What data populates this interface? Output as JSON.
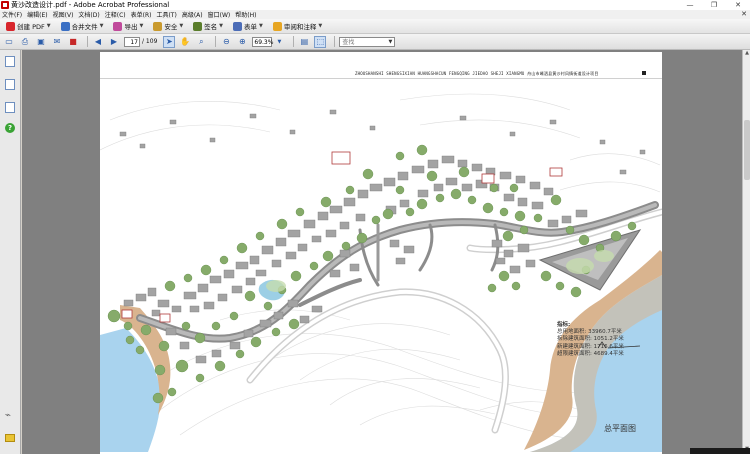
{
  "window": {
    "title": "黄沙改造设计.pdf - Adobe Acrobat Professional",
    "controls": [
      "—",
      "❐",
      "✕"
    ]
  },
  "menu": {
    "items": [
      "文件(F)",
      "编辑(E)",
      "视图(V)",
      "文档(D)",
      "注释(C)",
      "表单(R)",
      "工具(T)",
      "高级(A)",
      "窗口(W)",
      "帮助(H)"
    ]
  },
  "toolbar": {
    "create_pdf": "创建 PDF",
    "merge_files": "合并文件",
    "export": "导出",
    "secure": "安全",
    "sign": "签名",
    "forms": "表单",
    "review_comment": "审阅和注释"
  },
  "nav": {
    "current_page": "17",
    "total_pages": "/ 109",
    "zoom": "69.3%",
    "search_placeholder": "查找"
  },
  "document": {
    "header_text": "ZHOUSHANSHI SHENGSIXIAN HUANGSHACUN FENGQING JIEDAO SHEJI XIANGMU 舟山市嵊泗县黄沙村风情街道设计项目",
    "legend_title": "指标:",
    "legend_rows": [
      "总用地面积: 33960.7平米",
      "拆除建筑面积: 1051.2平米",
      "新建建筑面积: 1716.6平米",
      "超限建筑面积: 4689.4平米"
    ],
    "plan_title": "总平面图"
  },
  "colors": {
    "toolbar_bg": "#e8e8e8",
    "workspace_bg": "#808080",
    "sea": "#a9d3ee",
    "beach": "#d9b48f",
    "road": "#8c8c8c",
    "building": "#a3a3a3",
    "tree": "#86ab6a"
  }
}
